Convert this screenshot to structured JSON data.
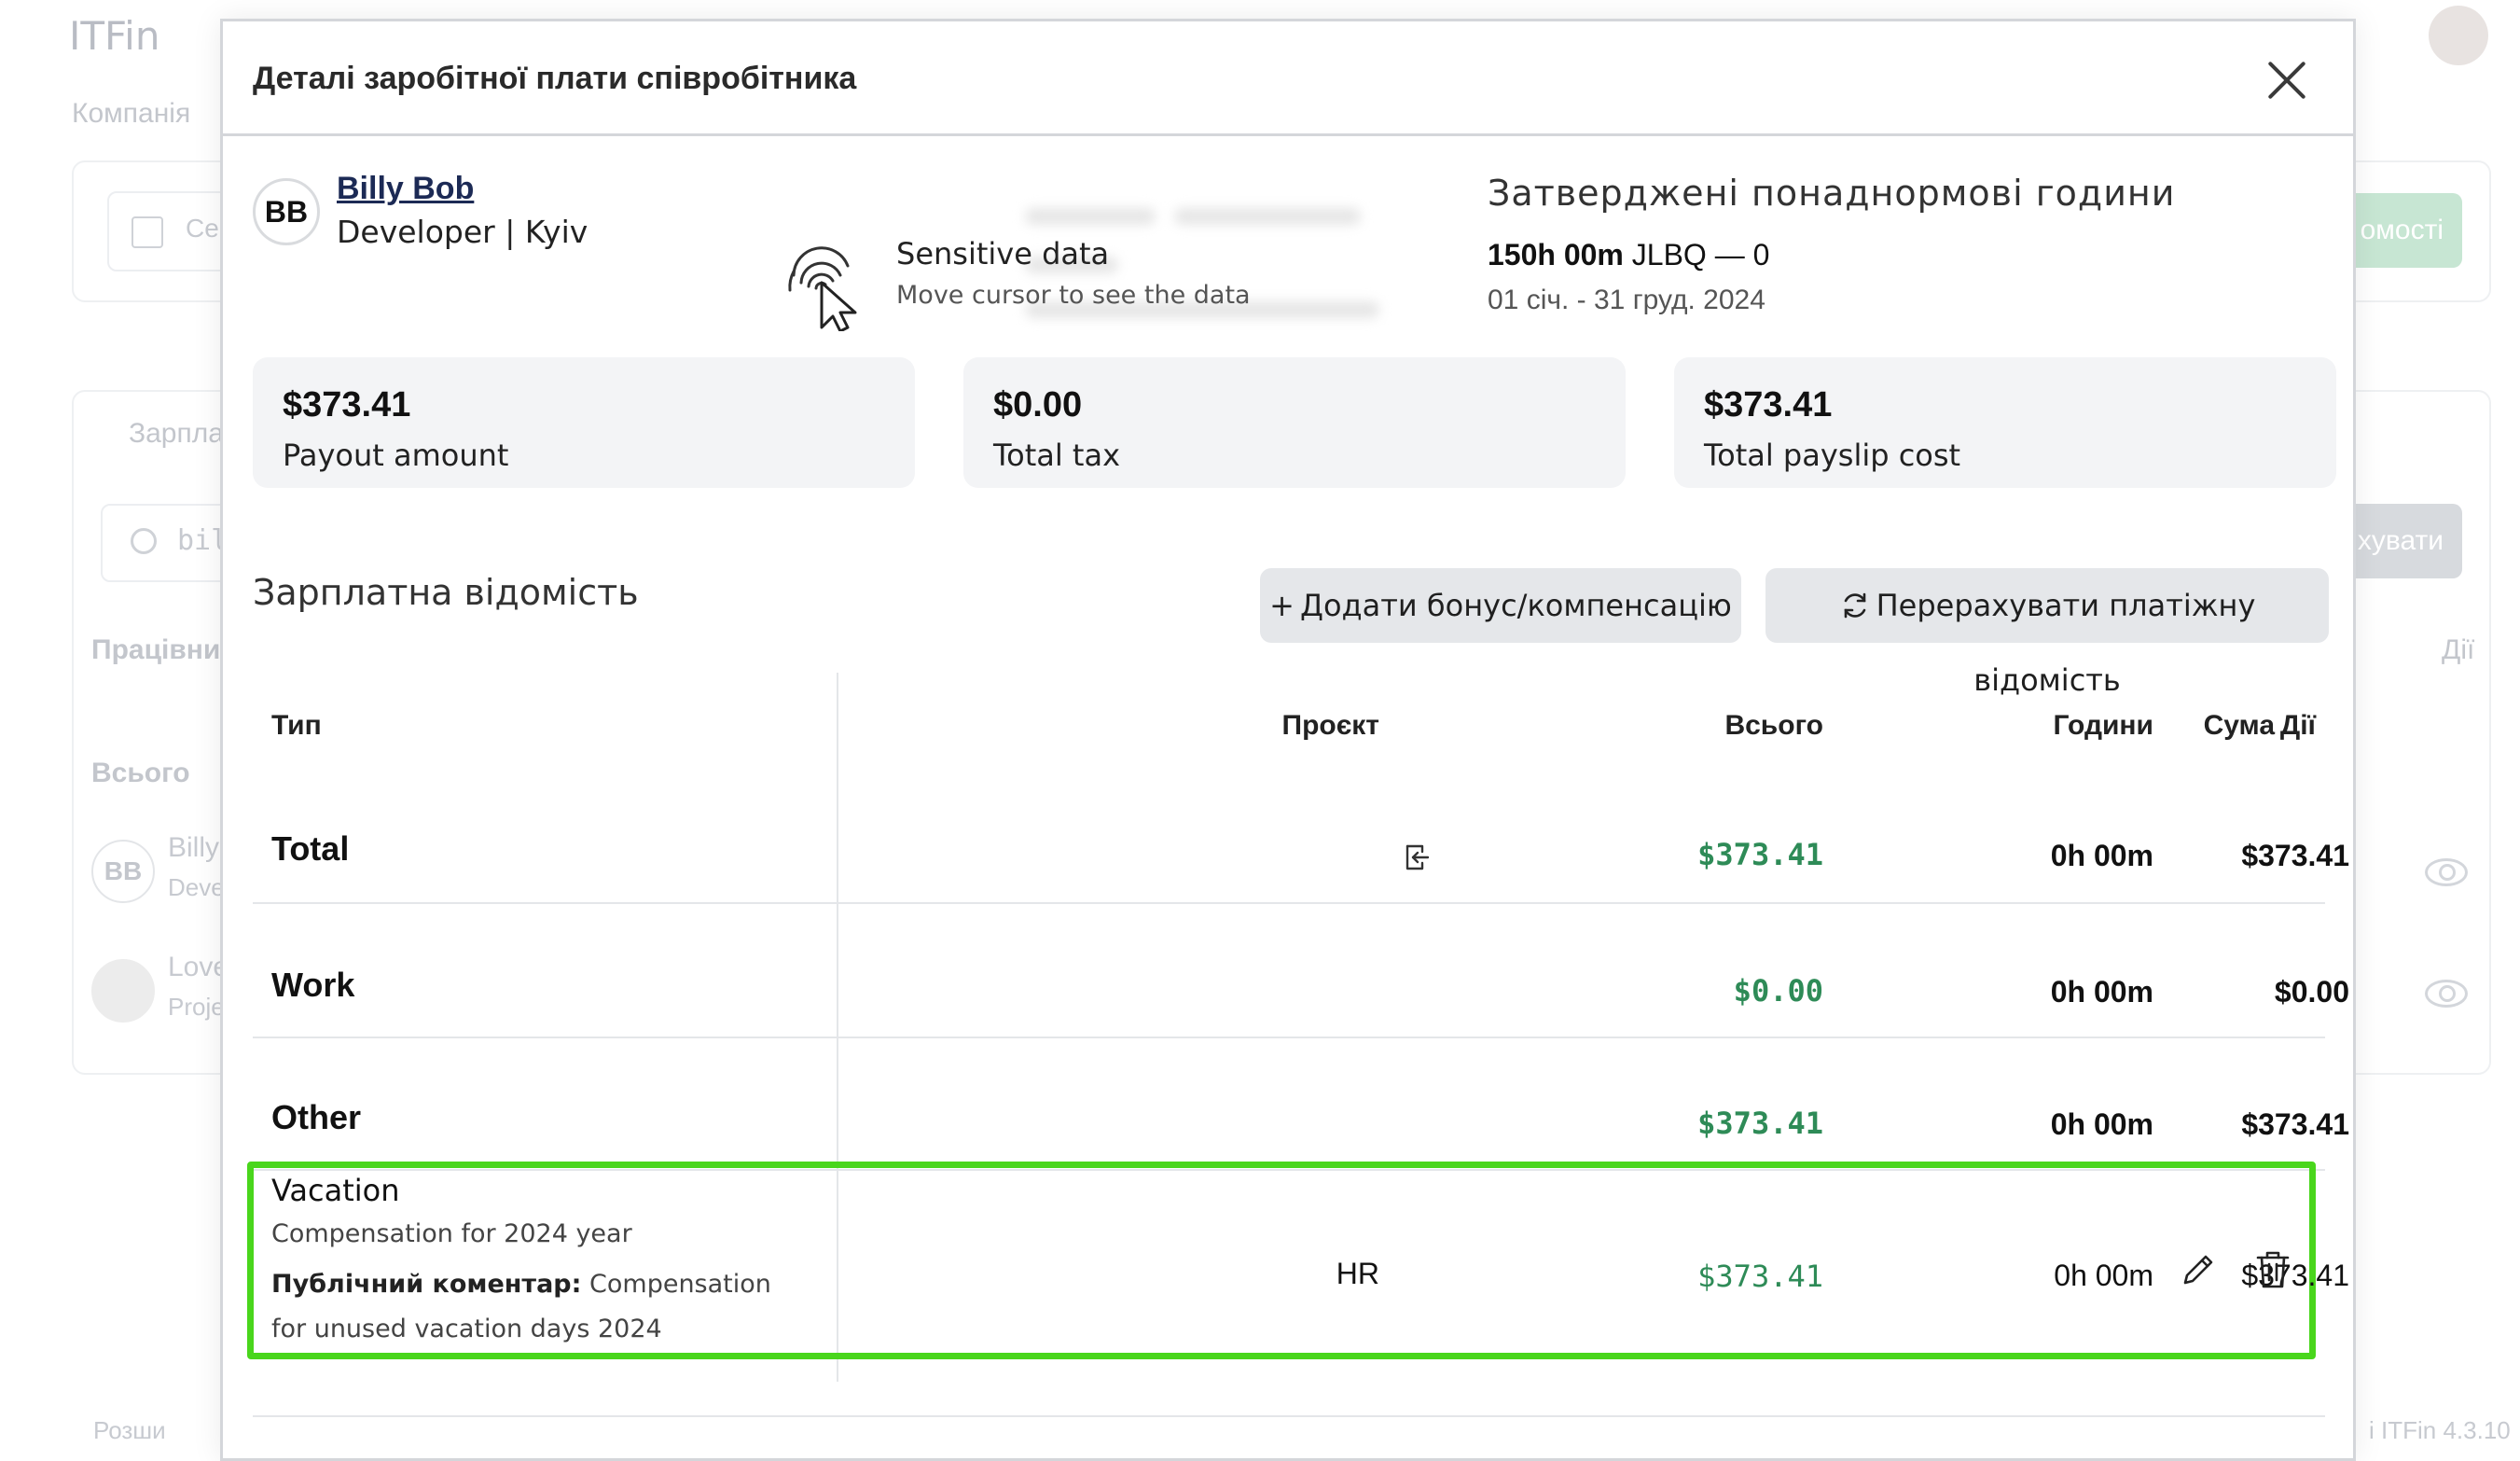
{
  "background": {
    "logo": "ITFin",
    "breadcrumb": "Компанія",
    "date_filter_partial": "Се",
    "green_button_partial": "омості",
    "tab_partial": "Зарпла",
    "search_partial": "bil",
    "gray_button_partial": "хувати",
    "col_employee_partial": "Працівни",
    "col_actions": "Дії",
    "total_label": "Всього",
    "rows": [
      {
        "avatar": "BB",
        "name_partial": "Billy",
        "role_partial": "Deve"
      },
      {
        "avatar": "",
        "name_partial": "Love",
        "role_partial": "Proje"
      }
    ],
    "footer_partial": "Розши",
    "version_partial": "i ITFin 4.3.10"
  },
  "modal": {
    "title": "Деталі заробітної плати співробітника",
    "employee": {
      "initials": "BB",
      "name": "Billy Bob",
      "role": "Developer | Kyiv"
    },
    "sensitive": {
      "title": "Sensitive data",
      "subtitle": "Move cursor to see the data"
    },
    "overtime": {
      "title": "Затверджені понаднормові години",
      "hours": "150h 00m",
      "code": "JLBQ — 0",
      "range": "01 січ. - 31 груд. 2024"
    },
    "stats": [
      {
        "value": "$373.41",
        "label": "Payout amount"
      },
      {
        "value": "$0.00",
        "label": "Total tax"
      },
      {
        "value": "$373.41",
        "label": "Total payslip cost"
      }
    ],
    "section_title": "Зарплатна відомість",
    "add_bonus_label": "Додати бонус/компенсацію",
    "recalc_label": "Перерахувати платіжну відомість",
    "columns": {
      "type": "Тип",
      "project": "Проєкт",
      "total": "Всього",
      "hours": "Години",
      "amount": "Сума",
      "actions": "Дії"
    },
    "rows": [
      {
        "type": "Total",
        "project": "",
        "total": "$373.41",
        "hours": "0h 00m",
        "amount": "$373.41"
      },
      {
        "type": "Work",
        "project": "",
        "total": "$0.00",
        "hours": "0h 00m",
        "amount": "$0.00"
      },
      {
        "type": "Other",
        "project": "",
        "total": "$373.41",
        "hours": "0h 00m",
        "amount": "$373.41"
      }
    ],
    "vacation": {
      "type": "Vacation",
      "description": "Compensation for 2024 year",
      "comment_label": "Публічний коментар:",
      "comment": "Compensation for unused vacation days 2024",
      "project": "HR",
      "total": "$373.41",
      "hours": "0h 00m",
      "amount": "$373.41"
    },
    "colors": {
      "money": "#2e8b57",
      "highlight": "#49d61c",
      "stat_bg": "#f3f4f6"
    }
  }
}
